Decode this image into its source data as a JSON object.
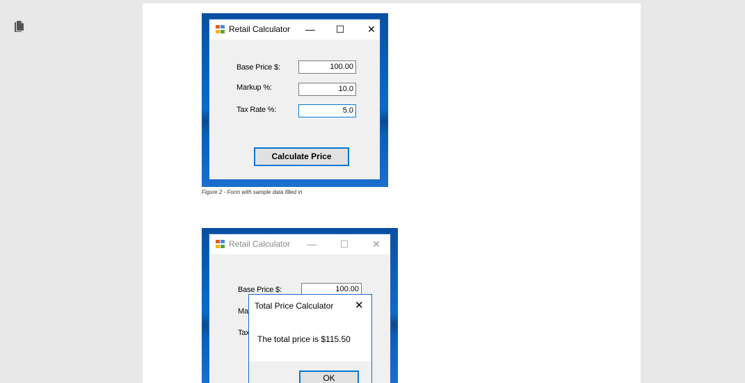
{
  "window1": {
    "title": "Retail Calculator",
    "minimize": "—",
    "maximize": "☐",
    "close": "✕",
    "labels": {
      "base_price": "Base Price $:",
      "markup": "Markup %:",
      "tax_rate": "Tax Rate %:"
    },
    "values": {
      "base_price": "100.00",
      "markup": "10.0",
      "tax_rate": "5.0"
    },
    "button": "Calculate Price"
  },
  "caption": "Figure 2 - Form with sample data filled in",
  "window2": {
    "title": "Retail Calculator",
    "minimize": "—",
    "maximize": "☐",
    "close": "✕",
    "labels": {
      "base_price": "Base Price $:",
      "markup_partial": "Ma",
      "tax_partial": "Tax"
    },
    "values": {
      "base_price": "100.00"
    }
  },
  "messagebox": {
    "title": "Total Price Calculator",
    "close": "✕",
    "text": "The total price is $115.50",
    "ok": "OK"
  }
}
